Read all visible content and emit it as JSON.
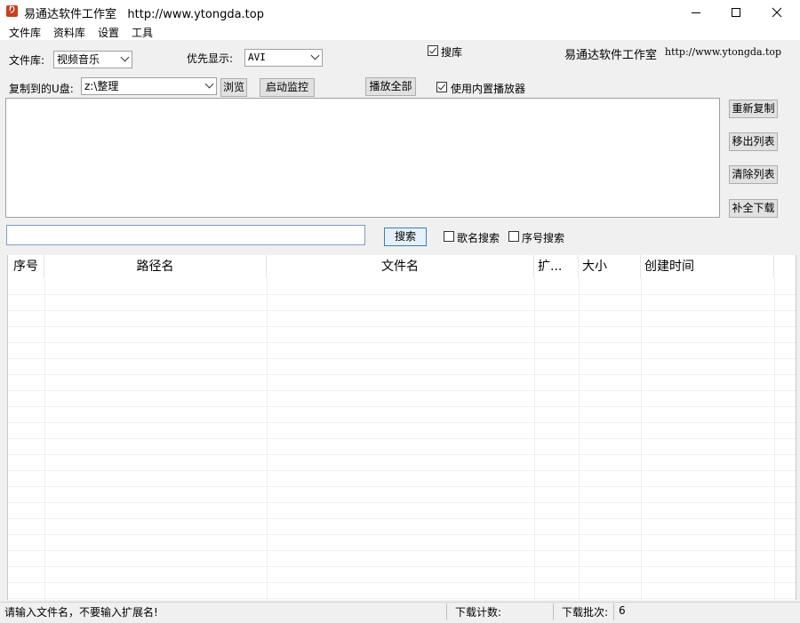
{
  "window": {
    "title": "易通达软件工作室",
    "url": "http://www.ytongda.top",
    "icon_letter": "り"
  },
  "menu": [
    "文件库",
    "资料库",
    "设置",
    "工具"
  ],
  "library": {
    "label": "文件库:",
    "value": "视频音乐"
  },
  "priority": {
    "label": "优先显示:",
    "value": "AVI"
  },
  "search_lib": {
    "label": "搜库",
    "checked": true
  },
  "studio": {
    "name": "易通达软件工作室",
    "url": "http://www.ytongda.top"
  },
  "copy_to": {
    "label": "复制到的U盘:",
    "value": "z:\\整理"
  },
  "buttons": {
    "browse": "浏览",
    "start_monitor": "启动监控",
    "play_all": "播放全部",
    "recopy": "重新复制",
    "move_out": "移出列表",
    "clear_list": "清除列表",
    "complete_download": "补全下载",
    "search": "搜索"
  },
  "builtin_player": {
    "label": "使用内置播放器",
    "checked": true
  },
  "search": {
    "value": ""
  },
  "song_search": {
    "label": "歌名搜索",
    "checked": false
  },
  "seq_search": {
    "label": "序号搜索",
    "checked": false
  },
  "table": {
    "columns": [
      "序号",
      "路径名",
      "文件名",
      "扩...",
      "大小",
      "创建时间"
    ],
    "rows": []
  },
  "status": {
    "hint": "请输入文件名，不要输入扩展名!",
    "download_count_label": "下载计数:",
    "download_count": "",
    "batch_label": "下载批次:",
    "batch": "6"
  }
}
